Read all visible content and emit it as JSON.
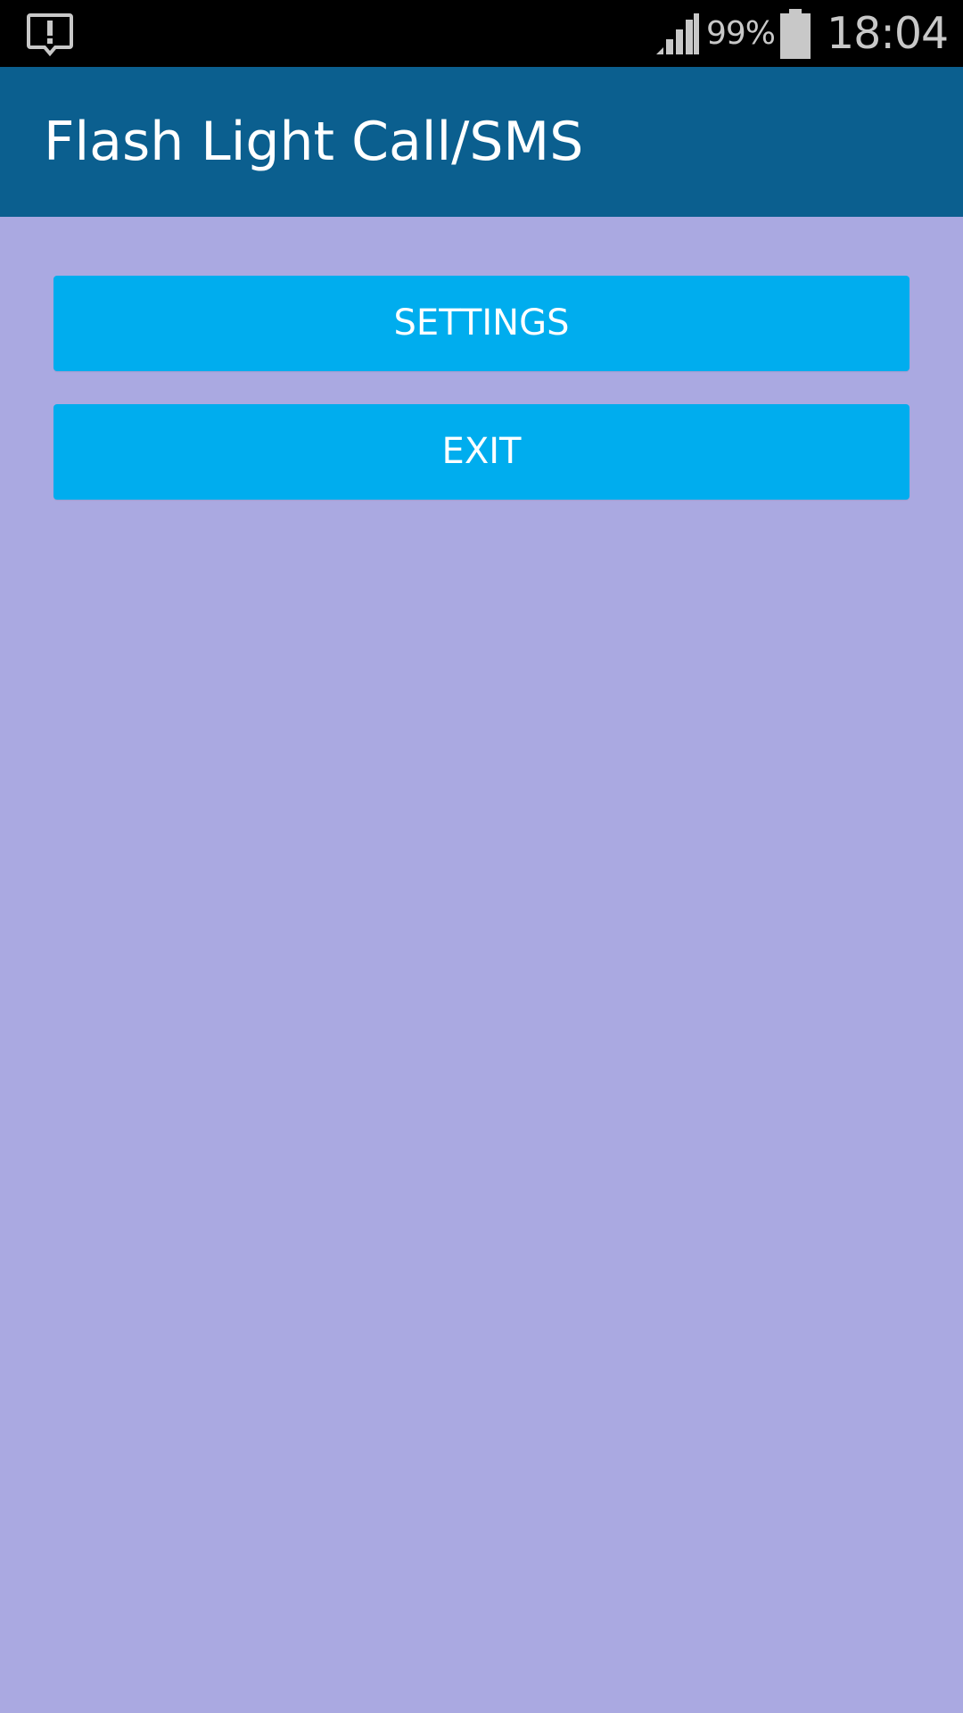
{
  "status_bar": {
    "battery_percent": "99%",
    "time": "18:04",
    "icons": [
      "alert-icon",
      "signal-icon",
      "battery-icon"
    ]
  },
  "app_bar": {
    "title": "Flash Light Call/SMS"
  },
  "buttons": {
    "settings_label": "SETTINGS",
    "exit_label": "EXIT"
  },
  "colors": {
    "status_bar_bg": "#000000",
    "app_bar_bg": "#0b5f8f",
    "page_bg": "#aaa9e1",
    "button_bg": "#00adee",
    "button_text": "#ffffff"
  }
}
